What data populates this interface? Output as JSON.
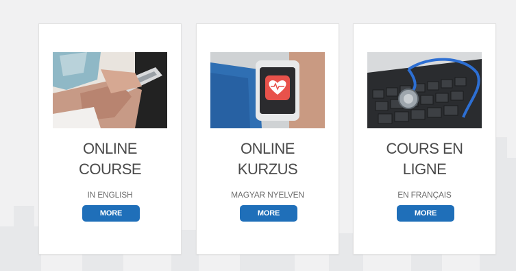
{
  "cards": [
    {
      "title_line1": "ONLINE",
      "title_line2": "COURSE",
      "subtitle": "IN ENGLISH",
      "button_label": "MORE",
      "image_icon": "hands-phone-photo"
    },
    {
      "title_line1": "ONLINE",
      "title_line2": "KURZUS",
      "subtitle": "MAGYAR NYELVEN",
      "button_label": "MORE",
      "image_icon": "smartwatch-heart-photo"
    },
    {
      "title_line1": "COURS EN",
      "title_line2": "LIGNE",
      "subtitle": "EN FRANÇAIS",
      "button_label": "MORE",
      "image_icon": "stethoscope-keyboard-photo"
    }
  ],
  "colors": {
    "background": "#f1f1f2",
    "card": "#ffffff",
    "title_text": "#4a4a4a",
    "subtitle_text": "#6e6e6e",
    "button": "#1f6fb9",
    "button_text": "#ffffff"
  }
}
